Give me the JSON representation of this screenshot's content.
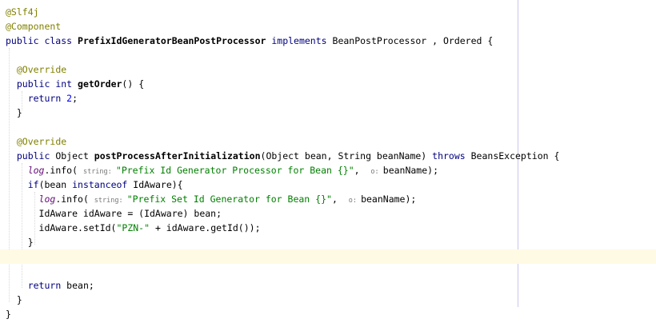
{
  "editor": {
    "lines": [
      {
        "parts": [
          {
            "c": "ann",
            "t": "@Slf4j"
          }
        ]
      },
      {
        "parts": [
          {
            "c": "ann",
            "t": "@Component"
          }
        ]
      },
      {
        "parts": [
          {
            "c": "kw",
            "t": "public class "
          },
          {
            "c": "cls",
            "t": "PrefixIdGeneratorBeanPostProcessor "
          },
          {
            "c": "kw",
            "t": "implements "
          },
          {
            "c": "plain",
            "t": "BeanPostProcessor , Ordered {"
          }
        ]
      },
      {
        "parts": []
      },
      {
        "parts": [
          {
            "c": "plain",
            "t": "  "
          },
          {
            "c": "ann",
            "t": "@Override"
          }
        ]
      },
      {
        "parts": [
          {
            "c": "plain",
            "t": "  "
          },
          {
            "c": "kw",
            "t": "public int "
          },
          {
            "c": "meth",
            "t": "getOrder"
          },
          {
            "c": "plain",
            "t": "() {"
          }
        ]
      },
      {
        "parts": [
          {
            "c": "plain",
            "t": "    "
          },
          {
            "c": "kw",
            "t": "return "
          },
          {
            "c": "num",
            "t": "2"
          },
          {
            "c": "plain",
            "t": ";"
          }
        ]
      },
      {
        "parts": [
          {
            "c": "plain",
            "t": "  }"
          }
        ]
      },
      {
        "parts": []
      },
      {
        "parts": [
          {
            "c": "plain",
            "t": "  "
          },
          {
            "c": "ann",
            "t": "@Override"
          }
        ]
      },
      {
        "parts": [
          {
            "c": "plain",
            "t": "  "
          },
          {
            "c": "kw",
            "t": "public "
          },
          {
            "c": "plain",
            "t": "Object "
          },
          {
            "c": "meth",
            "t": "postProcessAfterInitialization"
          },
          {
            "c": "plain",
            "t": "(Object bean, String beanName) "
          },
          {
            "c": "kw",
            "t": "throws "
          },
          {
            "c": "plain",
            "t": "BeansException {"
          }
        ]
      },
      {
        "parts": [
          {
            "c": "plain",
            "t": "    "
          },
          {
            "c": "field",
            "t": "log"
          },
          {
            "c": "plain",
            "t": ".info( "
          },
          {
            "c": "hint",
            "t": "string: "
          },
          {
            "c": "str",
            "t": "\"Prefix Id Generator Processor for Bean {}\""
          },
          {
            "c": "plain",
            "t": ",  "
          },
          {
            "c": "hint",
            "t": "o: "
          },
          {
            "c": "plain",
            "t": "beanName);"
          }
        ]
      },
      {
        "parts": [
          {
            "c": "plain",
            "t": "    "
          },
          {
            "c": "kw",
            "t": "if"
          },
          {
            "c": "plain",
            "t": "(bean "
          },
          {
            "c": "kw",
            "t": "instanceof "
          },
          {
            "c": "plain",
            "t": "IdAware){"
          }
        ]
      },
      {
        "parts": [
          {
            "c": "plain",
            "t": "      "
          },
          {
            "c": "field",
            "t": "log"
          },
          {
            "c": "plain",
            "t": ".info( "
          },
          {
            "c": "hint",
            "t": "string: "
          },
          {
            "c": "str",
            "t": "\"Prefix Set Id Generator for Bean {}\""
          },
          {
            "c": "plain",
            "t": ",  "
          },
          {
            "c": "hint",
            "t": "o: "
          },
          {
            "c": "plain",
            "t": "beanName);"
          }
        ]
      },
      {
        "parts": [
          {
            "c": "plain",
            "t": "      IdAware idAware = (IdAware) bean;"
          }
        ]
      },
      {
        "parts": [
          {
            "c": "plain",
            "t": "      idAware.setId("
          },
          {
            "c": "str",
            "t": "\"PZN-\""
          },
          {
            "c": "plain",
            "t": " + idAware.getId());"
          }
        ]
      },
      {
        "parts": [
          {
            "c": "plain",
            "t": "    }"
          }
        ]
      },
      {
        "parts": [],
        "current": true
      },
      {
        "parts": []
      },
      {
        "parts": [
          {
            "c": "plain",
            "t": "    "
          },
          {
            "c": "kw",
            "t": "return "
          },
          {
            "c": "plain",
            "t": "bean;"
          }
        ]
      },
      {
        "parts": [
          {
            "c": "plain",
            "t": "  }"
          }
        ]
      },
      {
        "parts": [
          {
            "c": "plain",
            "t": "}"
          }
        ]
      }
    ]
  }
}
